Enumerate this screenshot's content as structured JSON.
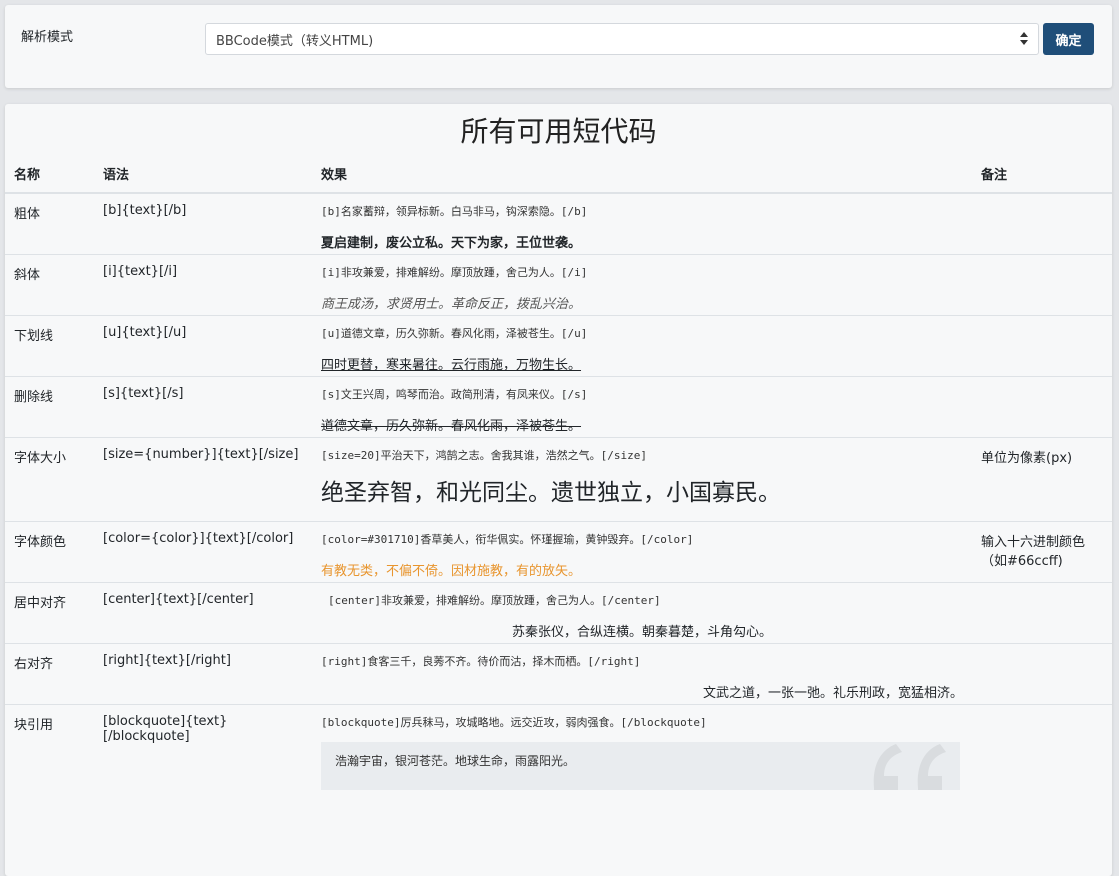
{
  "mode": {
    "label": "解析模式",
    "selected": "BBCode模式（转义HTML)",
    "confirm": "确定"
  },
  "title": "所有可用短代码",
  "headers": {
    "name": "名称",
    "syntax": "语法",
    "effect": "效果",
    "note": "备注"
  },
  "rows": [
    {
      "name": "粗体",
      "syntax": "[b]{text}[/b]",
      "code": "[b]名家蓄辩，领异标新。白马非马，钩深索隐。[/b]",
      "effect": "夏启建制，废公立私。天下为家，王位世袭。",
      "note": ""
    },
    {
      "name": "斜体",
      "syntax": "[i]{text}[/i]",
      "code": "[i]非攻兼爱，排难解纷。摩顶放踵，舍己为人。[/i]",
      "effect": "商王成汤，求贤用士。革命反正，拨乱兴治。",
      "note": ""
    },
    {
      "name": "下划线",
      "syntax": "[u]{text}[/u]",
      "code": "[u]道德文章，历久弥新。春风化雨，泽被苍生。[/u]",
      "effect": "四时更替，寒来暑往。云行雨施，万物生长。",
      "note": ""
    },
    {
      "name": "删除线",
      "syntax": "[s]{text}[/s]",
      "code": "[s]文王兴周，鸣琴而治。政简刑清，有凤来仪。[/s]",
      "effect": "道德文章，历久弥新。春风化雨，泽被苍生。",
      "note": ""
    },
    {
      "name": "字体大小",
      "syntax": "[size={number}]{text}[/size]",
      "code": "[size=20]平治天下，鸿鹄之志。舍我其谁，浩然之气。[/size]",
      "effect": "绝圣弃智，和光同尘。遗世独立，小国寡民。",
      "note": "单位为像素(px)"
    },
    {
      "name": "字体颜色",
      "syntax": "[color={color}]{text}[/color]",
      "code": "[color=#301710]香草美人，衔华佩实。怀瑾握瑜，黄钟毁弃。[/color]",
      "effect": "有教无类，不偏不倚。因材施教，有的放矢。",
      "note": "输入十六进制颜色（如#66ccff)"
    },
    {
      "name": "居中对齐",
      "syntax": "[center]{text}[/center]",
      "code": "[center]非攻兼爱，排难解纷。摩顶放踵，舍己为人。[/center]",
      "effect": "苏秦张仪，合纵连横。朝秦暮楚，斗角勾心。",
      "note": ""
    },
    {
      "name": "右对齐",
      "syntax": "[right]{text}[/right]",
      "code": "[right]食客三千，良莠不齐。待价而沽，择木而栖。[/right]",
      "effect": "文武之道，一张一弛。礼乐刑政，宽猛相济。",
      "note": ""
    },
    {
      "name": "块引用",
      "syntax": "[blockquote]{text}[/blockquote]",
      "code": "[blockquote]厉兵秣马，攻城略地。远交近攻，弱肉强食。[/blockquote]",
      "effect": "浩瀚宇宙，银河苍茫。地球生命，雨露阳光。",
      "note": ""
    }
  ],
  "colors": {
    "accent": "#1f4e79",
    "color_effect": "#e8952e"
  },
  "icons": {
    "select": "chevron-updown-icon",
    "quote": "quote-mark-icon"
  }
}
